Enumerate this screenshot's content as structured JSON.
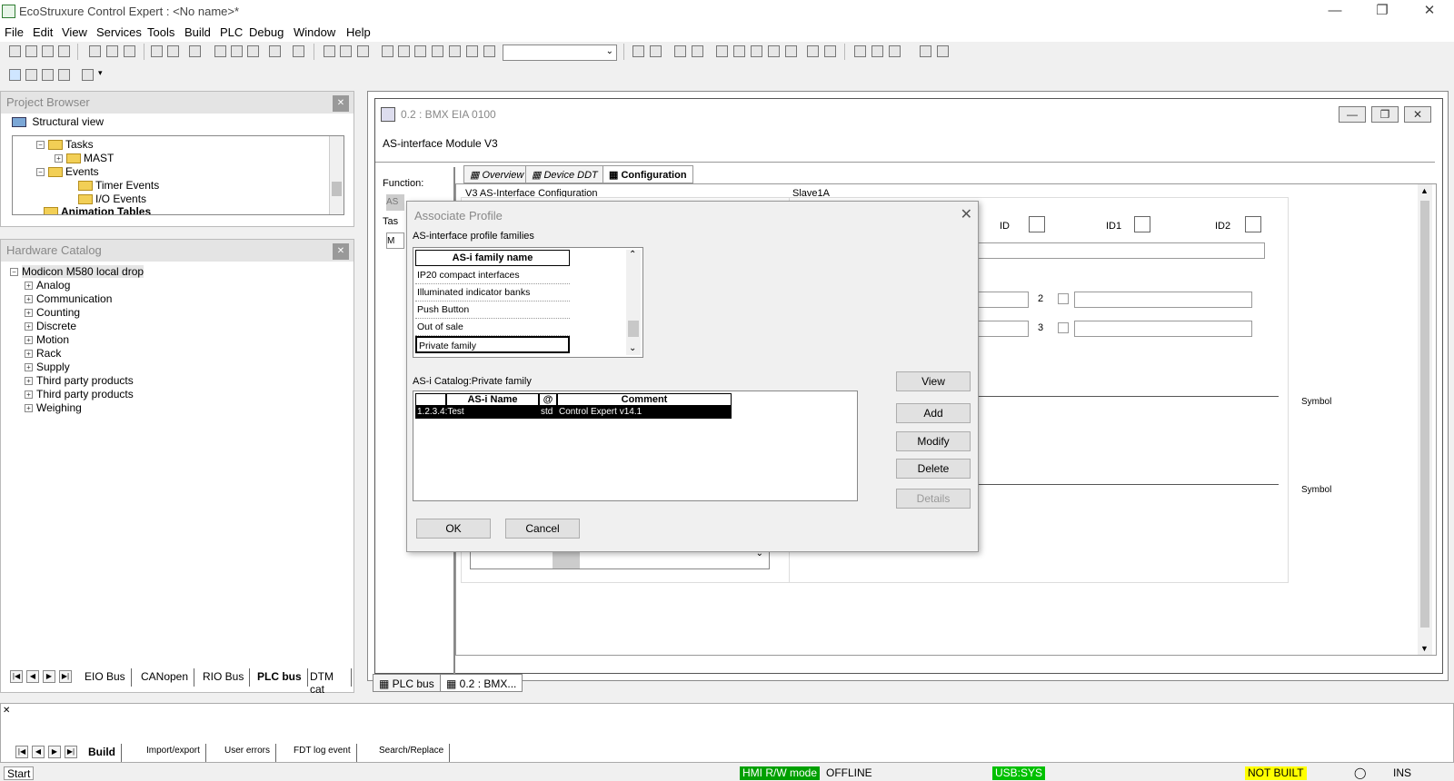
{
  "window": {
    "title": "EcoStruxure Control Expert : <No name>*",
    "minimize": "—",
    "maximize": "❐",
    "close": "✕"
  },
  "menu": [
    "File",
    "Edit",
    "View",
    "Services",
    "Tools",
    "Build",
    "PLC",
    "Debug",
    "Window",
    "Help"
  ],
  "project_browser": {
    "title": "Project Browser",
    "view_label": "Structural view",
    "tree": [
      {
        "label": "Tasks",
        "expander": "−",
        "indent": 1
      },
      {
        "label": "MAST",
        "expander": "+",
        "indent": 2
      },
      {
        "label": "Events",
        "expander": "−",
        "indent": 1
      },
      {
        "label": "Timer Events",
        "expander": "",
        "indent": 2
      },
      {
        "label": "I/O Events",
        "expander": "",
        "indent": 2
      },
      {
        "label": "Animation Tables",
        "expander": "",
        "indent": 0
      }
    ]
  },
  "hardware_catalog": {
    "title": "Hardware Catalog",
    "root": "Modicon M580 local drop",
    "items": [
      "Analog",
      "Communication",
      "Counting",
      "Discrete",
      "Motion",
      "Rack",
      "Supply",
      "Third party products",
      "Third party products",
      "Weighing"
    ],
    "tabs": [
      "EIO Bus",
      "CANopen",
      "RIO Bus",
      "PLC bus",
      "DTM cat"
    ],
    "active_tab": "PLC bus"
  },
  "module_window": {
    "title": "0.2 : BMX EIA 0100",
    "subtitle": "AS-interface Module V3",
    "tabs": [
      "Overview",
      "Device DDT",
      "Configuration"
    ],
    "function_label": "Function:",
    "task_label": "Tas",
    "config_label": "V3 AS-Interface Configuration",
    "slave_label": "Slave1A",
    "id_labels": [
      "ID",
      "ID1",
      "ID2"
    ],
    "row_labels": [
      "2",
      "3"
    ],
    "symbol_header": "Symbol",
    "left_field_a": "AS",
    "left_field_m": "M"
  },
  "dialog": {
    "title": "Associate Profile",
    "families_label": "AS-interface profile families",
    "family_header": "AS-i family name",
    "families": [
      "IP20 compact interfaces",
      "Illuminated indicator banks",
      "Push Button",
      "Out of sale",
      "Private family"
    ],
    "selected_family": "Private family",
    "catalog_label": "AS-i Catalog:Private family",
    "catalog_headers": [
      "AS-i Name",
      "@",
      "Comment"
    ],
    "catalog_rows": [
      {
        "name": "1.2.3.4:Test",
        "at": "std",
        "comment": "Control Expert v14.1"
      }
    ],
    "buttons": {
      "view": "View",
      "add": "Add",
      "modify": "Modify",
      "delete": "Delete",
      "details": "Details",
      "ok": "OK",
      "cancel": "Cancel"
    }
  },
  "mdi_tabs": [
    "PLC bus",
    "0.2 : BMX..."
  ],
  "output": {
    "tabs": [
      "Build",
      "Import/export",
      "User errors",
      "FDT log event",
      "Search/Replace"
    ],
    "active_tab": "Build"
  },
  "status": {
    "start": "Start",
    "hmi": "HMI R/W mode",
    "mode": "OFFLINE",
    "conn": "USB:SYS",
    "build": "NOT BUILT",
    "ins": "INS",
    "hmi_color": "#00a000",
    "conn_color": "#00c000",
    "build_color": "#ffff00"
  }
}
